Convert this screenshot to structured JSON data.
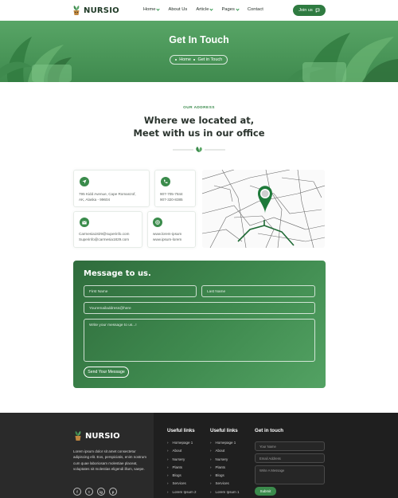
{
  "header": {
    "brand": "NURSIO",
    "nav": [
      {
        "label": "Home",
        "has_dropdown": true
      },
      {
        "label": "About Us",
        "has_dropdown": false
      },
      {
        "label": "Article",
        "has_dropdown": true
      },
      {
        "label": "Pages",
        "has_dropdown": true
      },
      {
        "label": "Contact",
        "has_dropdown": false
      }
    ],
    "join_label": "Join us",
    "accent_color": "#2f7b41"
  },
  "hero": {
    "title": "Get In Touch",
    "breadcrumb": [
      "Home",
      "Get in Touch"
    ],
    "background": "#4d9a5c"
  },
  "address_section": {
    "kicker": "OUR ADDRESS",
    "heading_line1": "Where we located at,",
    "heading_line2": "Meet with us in our office",
    "cards": {
      "location": {
        "line1": "795 Kidd Avenue, Cape Romanzof,",
        "line2": "AK, Alaska - 99604",
        "icon": "location-arrow-icon"
      },
      "phone": {
        "line1": "907-705-7844",
        "line2": "907-320-8385",
        "icon": "phone-icon"
      },
      "email": {
        "line1": "Carmesia1829@superinfo.com",
        "line2": "Superinfo@carmesia1829.com",
        "icon": "envelope-icon"
      },
      "web": {
        "line1": "www.lorem-ipsum",
        "line2": "www.ipsum-lorem",
        "icon": "globe-icon"
      }
    }
  },
  "message_form": {
    "title": "Message to us.",
    "first_name_placeholder": "First Name",
    "last_name_placeholder": "Last Name",
    "email_placeholder": "Youremailaddress@here",
    "message_placeholder": "Write your message to us...!",
    "send_label": "Send Your Message"
  },
  "footer": {
    "brand": "NURSIO",
    "about": "Lorem ipsum dolor sit amet consectetur adipiscing elit. Eos, perspiciatis, enim nostrum cum quae laboriosam molestiae placeat, voluptates sit molestias eligendi illum, saepe.",
    "socials": [
      "f",
      "t",
      "ig",
      "p"
    ],
    "col1_title": "Useful links",
    "col1_items": [
      "Homepage 1",
      "About",
      "Nursery",
      "Plants",
      "Blogs",
      "Services",
      "Lorem Ipsum 2"
    ],
    "col2_title": "Useful links",
    "col2_items": [
      "Homepage 1",
      "About",
      "Nursery",
      "Plants",
      "Blogs",
      "Services",
      "Lorem Ipsum 1"
    ],
    "contact_title": "Get in touch",
    "name_placeholder": "Your Name",
    "email_placeholder": "Email Address",
    "message_placeholder": "Write A Message",
    "submit_label": "Submit"
  }
}
